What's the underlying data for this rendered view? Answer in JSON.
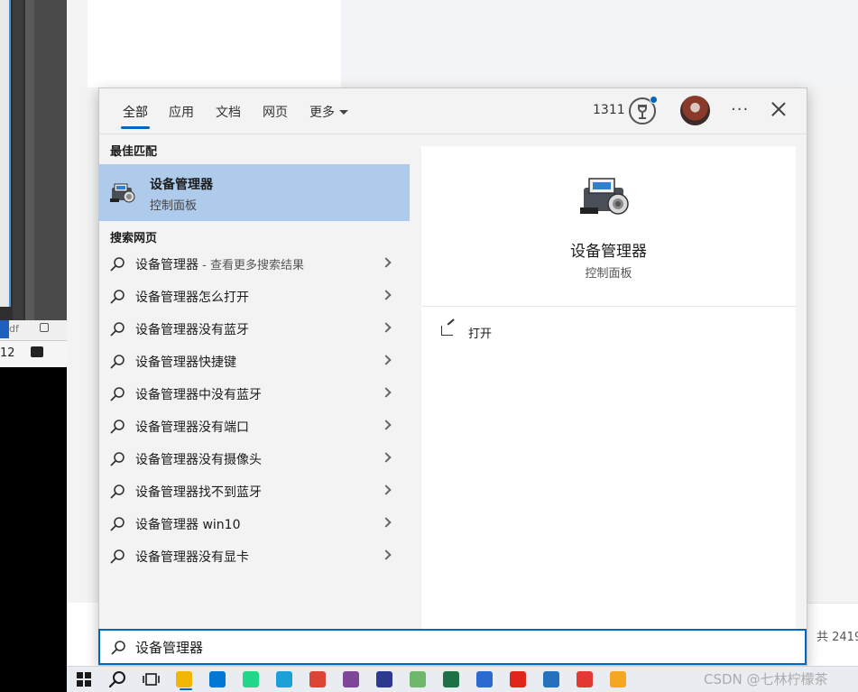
{
  "background": {
    "left_status_text": "df",
    "left_bottom_number": "12",
    "bottom_right_text": "共 2419"
  },
  "tabs": [
    {
      "label": "全部",
      "active": true
    },
    {
      "label": "应用",
      "active": false
    },
    {
      "label": "文档",
      "active": false
    },
    {
      "label": "网页",
      "active": false
    },
    {
      "label": "更多",
      "active": false,
      "dropdown": true
    }
  ],
  "header": {
    "points": "1311",
    "more_glyph": "···"
  },
  "best_match": {
    "section_title": "最佳匹配",
    "name": "设备管理器",
    "subtitle": "控制面板"
  },
  "web_search": {
    "section_title": "搜索网页",
    "results": [
      {
        "text": "设备管理器",
        "suffix": " - 查看更多搜索结果"
      },
      {
        "text": "设备管理器怎么打开",
        "suffix": ""
      },
      {
        "text": "设备管理器没有蓝牙",
        "suffix": ""
      },
      {
        "text": "设备管理器快捷键",
        "suffix": ""
      },
      {
        "text": "设备管理器中没有蓝牙",
        "suffix": ""
      },
      {
        "text": "设备管理器没有端口",
        "suffix": ""
      },
      {
        "text": "设备管理器没有摄像头",
        "suffix": ""
      },
      {
        "text": "设备管理器找不到蓝牙",
        "suffix": ""
      },
      {
        "text": "设备管理器 win10",
        "suffix": ""
      },
      {
        "text": "设备管理器没有显卡",
        "suffix": ""
      }
    ]
  },
  "preview": {
    "title": "设备管理器",
    "subtitle": "控制面板",
    "actions": [
      {
        "label": "打开",
        "icon": "open-icon"
      }
    ]
  },
  "search": {
    "value": "设备管理器"
  },
  "taskbar": {
    "items": [
      {
        "name": "start-button",
        "icon": "windows-logo",
        "color": "#1a1a1a"
      },
      {
        "name": "search-button",
        "icon": "search-icon",
        "color": "#1a1a1a"
      },
      {
        "name": "task-view-button",
        "icon": "task-view-icon",
        "color": "#1a1a1a"
      },
      {
        "name": "file-explorer",
        "icon": "folder-icon",
        "color": "#f2b705",
        "running": true
      },
      {
        "name": "vscode",
        "icon": "vscode-icon",
        "color": "#0078d4"
      },
      {
        "name": "clion",
        "icon": "clion-icon",
        "color": "#21d789"
      },
      {
        "name": "edge",
        "icon": "edge-icon",
        "color": "#1ba0d8"
      },
      {
        "name": "chrome",
        "icon": "chrome-icon",
        "color": "#db4437"
      },
      {
        "name": "tor-browser",
        "icon": "tor-icon",
        "color": "#7d4698"
      },
      {
        "name": "app-blue",
        "icon": "building-icon",
        "color": "#2b3a8f"
      },
      {
        "name": "notepad",
        "icon": "notepad-icon",
        "color": "#6fb86b"
      },
      {
        "name": "excel-like",
        "icon": "sheet-icon",
        "color": "#1e7145"
      },
      {
        "name": "remote-app",
        "icon": "remote-icon",
        "color": "#2a6ad1"
      },
      {
        "name": "youdao",
        "icon": "youdao-icon",
        "color": "#e0261c"
      },
      {
        "name": "powershell",
        "icon": "powershell-icon",
        "color": "#2671be"
      },
      {
        "name": "wps",
        "icon": "wps-icon",
        "color": "#e53935"
      },
      {
        "name": "weather",
        "icon": "weather-icon",
        "color": "#f5a623"
      }
    ],
    "watermark": "CSDN @七林柠檬茶"
  },
  "colors": {
    "accent": "#0067c0",
    "best_match_bg": "#aecbec"
  }
}
